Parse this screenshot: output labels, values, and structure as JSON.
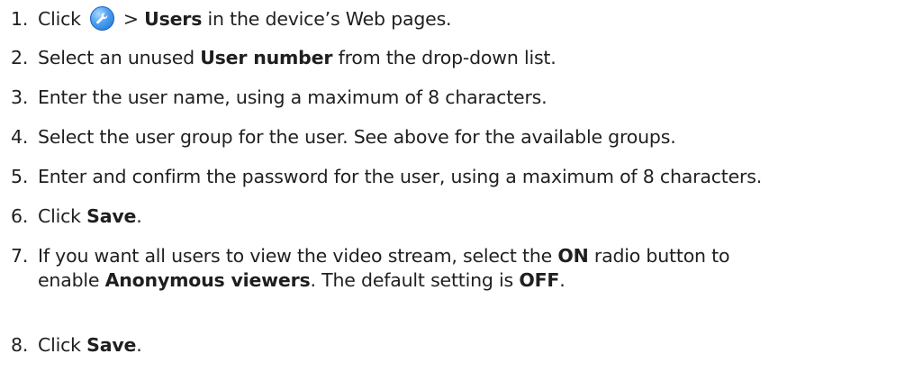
{
  "steps": [
    {
      "num": "1.",
      "parts": [
        "Click",
        "icon:wrench",
        "> ",
        "Users",
        " in the device’s Web pages."
      ]
    },
    {
      "num": "2.",
      "pre": "Select an unused ",
      "bold": "User number",
      "post": " from the drop-down list."
    },
    {
      "num": "3.",
      "text": "Enter the user name, using a maximum of 8 characters."
    },
    {
      "num": "4.",
      "text": "Select the user group for the user. See above for the available groups."
    },
    {
      "num": "5.",
      "text": "Enter and confirm the password for the user, using a maximum of 8 characters."
    },
    {
      "num": "6.",
      "pre": "Click ",
      "bold": "Save",
      "post": "."
    },
    {
      "num": "7.",
      "line1_pre": "If you want all users to view the video stream, select the ",
      "line1_bold": "ON",
      "line1_post": " radio button to",
      "line2_pre": "enable ",
      "line2_bold": "Anonymous viewers",
      "line2_mid": ". The default setting is ",
      "line2_bold2": "OFF",
      "line2_post": "."
    },
    {
      "num": "8.",
      "pre": "Click ",
      "bold": "Save",
      "post": "."
    }
  ],
  "icons": {
    "setup_icon": "wrench-icon"
  }
}
